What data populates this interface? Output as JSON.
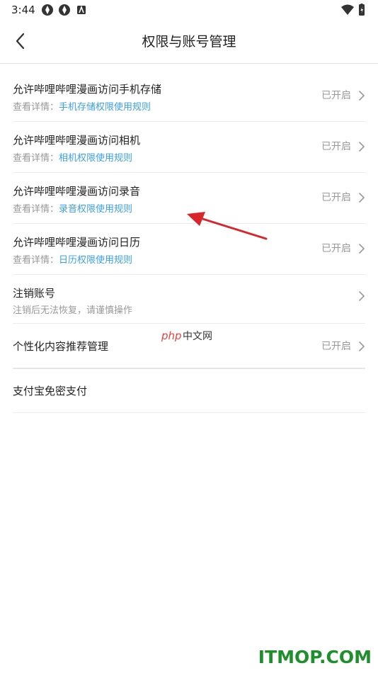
{
  "status_bar": {
    "time": "3:44"
  },
  "header": {
    "title": "权限与账号管理"
  },
  "rows": [
    {
      "title": "允许哔哩哔哩漫画访问手机存储",
      "sub_prefix": "查看详情：",
      "sub_link": "手机存储权限使用规则",
      "status": "已开启"
    },
    {
      "title": "允许哔哩哔哩漫画访问相机",
      "sub_prefix": "查看详情：",
      "sub_link": "相机权限使用规则",
      "status": "已开启"
    },
    {
      "title": "允许哔哩哔哩漫画访问录音",
      "sub_prefix": "查看详情：",
      "sub_link": "录音权限使用规则",
      "status": "已开启"
    },
    {
      "title": "允许哔哩哔哩漫画访问日历",
      "sub_prefix": "查看详情：",
      "sub_link": "日历权限使用规则",
      "status": "已开启"
    },
    {
      "title": "注销账号",
      "sub_text": "注销后无法恢复，请谨慎操作"
    },
    {
      "title": "个性化内容推荐管理",
      "status": "已开启"
    },
    {
      "title": "支付宝免密支付"
    }
  ],
  "watermarks": {
    "php_cn": "php 中文网",
    "itmop": "ITMOP.COM"
  },
  "colors": {
    "link": "#3aa0e6",
    "muted": "#999999",
    "annotation_arrow": "#d8262b",
    "watermark_green": "#1f8f2b"
  }
}
